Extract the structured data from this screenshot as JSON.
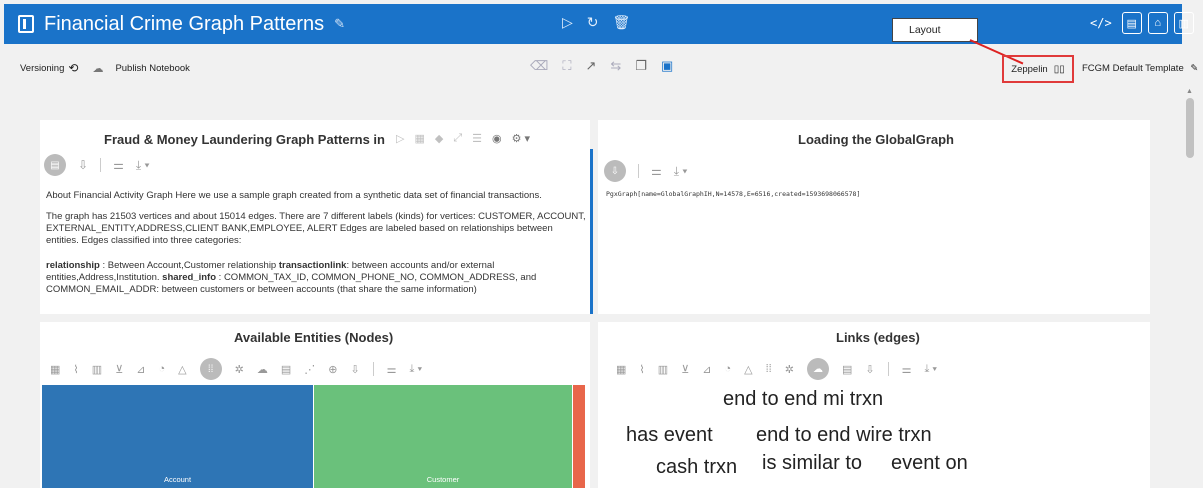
{
  "header": {
    "title": "Financial Crime Graph Patterns",
    "run_icon": "▷",
    "refresh_icon": "↻",
    "trash_icon": "🗑",
    "code_icon": "</>",
    "btn1": "▤",
    "btn2": "⌂",
    "btn3": "▥"
  },
  "toolbar": {
    "versioning": "Versioning",
    "publish": "Publish Notebook",
    "layout_callout": "Layout",
    "layout_value": "Zeppelin",
    "template": "FCGM Default Template"
  },
  "paragraphs": {
    "fraud": {
      "title": "Fraud & Money Laundering Graph Patterns in",
      "p1": "About Financial Activity Graph Here we use a sample graph created from a synthetic data set of financial transactions.",
      "p2": "The graph has 21503 vertices and about 15014 edges. There are 7 different labels (kinds) for vertices: CUSTOMER, ACCOUNT, EXTERNAL_ENTITY,ADDRESS,CLIENT BANK,EMPLOYEE, ALERT Edges are labeled based on relationships between entities. Edges classified into three categories:",
      "p3_b1": "relationship",
      "p3_t1": " : Between Account,Customer relationship ",
      "p3_b2": "transactionlink",
      "p3_t2": ": between accounts and/or external entities,Address,Institution. ",
      "p3_b3": "shared_info",
      "p3_t3": " : COMMON_TAX_ID, COMMON_PHONE_NO, COMMON_ADDRESS, and COMMON_EMAIL_ADDR: between customers or between accounts (that share the same information)"
    },
    "loading": {
      "title": "Loading the GlobalGraph",
      "output": "PgxGraph[name=GlobalGraphIH,N=14578,E=6516,created=1593698066578]"
    },
    "entities": {
      "title": "Available Entities (Nodes)",
      "cells": [
        {
          "label": "Account",
          "color": "#2e75b5"
        },
        {
          "label": "Customer",
          "color": "#6ac17b"
        },
        {
          "label": "",
          "color": "#e8664a"
        }
      ]
    },
    "links": {
      "title": "Links (edges)",
      "words": [
        "end to end mi trxn",
        "has event",
        "end to end wire trxn",
        "cash trxn",
        "is similar to",
        "event on"
      ]
    }
  }
}
